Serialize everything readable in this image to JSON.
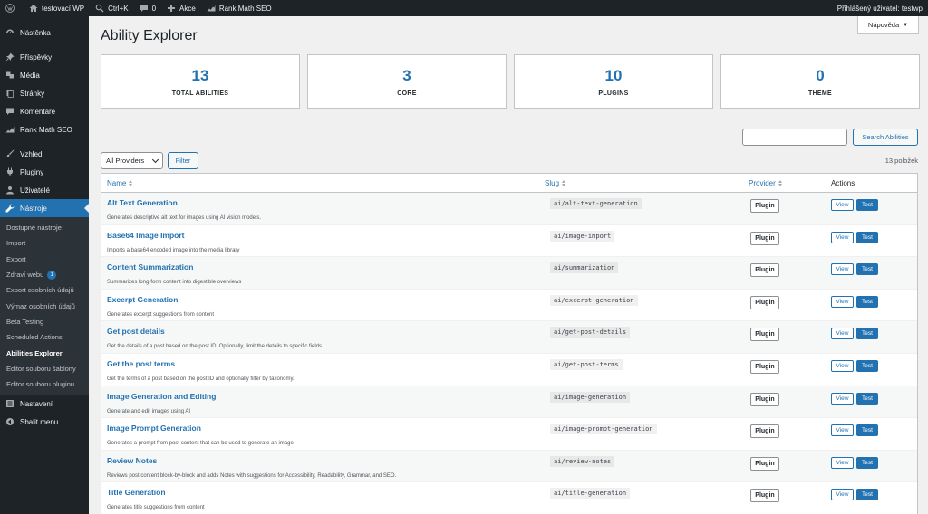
{
  "adminbar": {
    "site_name": "testovací WP",
    "shortcut": "Ctrl+K",
    "comments_count": "0",
    "new_label": "Akce",
    "rankmath_label": "Rank Math SEO",
    "user_greeting": "Přihlášený uživatel: testwp"
  },
  "sidebar": {
    "items": [
      {
        "label": "Nástěnka",
        "icon": "dashboard-icon"
      },
      {
        "label": "Příspěvky",
        "icon": "pin-icon"
      },
      {
        "label": "Média",
        "icon": "media-icon"
      },
      {
        "label": "Stránky",
        "icon": "pages-icon"
      },
      {
        "label": "Komentáře",
        "icon": "comment-icon"
      },
      {
        "label": "Rank Math SEO",
        "icon": "rankmath-icon"
      },
      {
        "label": "Vzhled",
        "icon": "brush-icon"
      },
      {
        "label": "Pluginy",
        "icon": "plugin-icon"
      },
      {
        "label": "Uživatelé",
        "icon": "users-icon"
      },
      {
        "label": "Nástroje",
        "icon": "wrench-icon"
      },
      {
        "label": "Nastavení",
        "icon": "settings-icon"
      },
      {
        "label": "Sbalit menu",
        "icon": "collapse-icon"
      }
    ],
    "submenu": [
      "Dostupné nástroje",
      "Import",
      "Export",
      "Zdraví webu",
      "Export osobních údajů",
      "Výmaz osobních údajů",
      "Beta Testing",
      "Scheduled Actions",
      "Abilities Explorer",
      "Editor souboru šablony",
      "Editor souboru pluginu"
    ],
    "health_badge": "1"
  },
  "main": {
    "help_label": "Nápověda",
    "title": "Ability Explorer",
    "stats": [
      {
        "value": "13",
        "label": "TOTAL ABILITIES"
      },
      {
        "value": "3",
        "label": "CORE"
      },
      {
        "value": "10",
        "label": "PLUGINS"
      },
      {
        "value": "0",
        "label": "THEME"
      }
    ],
    "search": {
      "value": "",
      "button_label": "Search Abilities"
    },
    "filter": {
      "selected": "All Providers",
      "button_label": "Filter"
    },
    "item_count": "13 položek",
    "table": {
      "headers": {
        "name": "Name",
        "slug": "Slug",
        "provider": "Provider",
        "actions": "Actions"
      },
      "view_label": "View",
      "test_label": "Test",
      "rows": [
        {
          "name": "Alt Text Generation",
          "desc": "Generates descriptive alt text for images using AI vision models.",
          "slug": "ai/alt-text-generation",
          "provider": "Plugin"
        },
        {
          "name": "Base64 Image Import",
          "desc": "Imports a base64 encoded image into the media library",
          "slug": "ai/image-import",
          "provider": "Plugin"
        },
        {
          "name": "Content Summarization",
          "desc": "Summarizes long-form content into digestible overviews",
          "slug": "ai/summarization",
          "provider": "Plugin"
        },
        {
          "name": "Excerpt Generation",
          "desc": "Generates excerpt suggestions from content",
          "slug": "ai/excerpt-generation",
          "provider": "Plugin"
        },
        {
          "name": "Get post details",
          "desc": "Get the details of a post based on the post ID. Optionally, limit the details to specific fields.",
          "slug": "ai/get-post-details",
          "provider": "Plugin"
        },
        {
          "name": "Get the post terms",
          "desc": "Get the terms of a post based on the post ID and optionally filter by taxonomy.",
          "slug": "ai/get-post-terms",
          "provider": "Plugin"
        },
        {
          "name": "Image Generation and Editing",
          "desc": "Generate and edit images using AI",
          "slug": "ai/image-generation",
          "provider": "Plugin"
        },
        {
          "name": "Image Prompt Generation",
          "desc": "Generates a prompt from post content that can be used to generate an image",
          "slug": "ai/image-prompt-generation",
          "provider": "Plugin"
        },
        {
          "name": "Review Notes",
          "desc": "Reviews post content block-by-block and adds Notes with suggestions for Accessibility, Readability, Grammar, and SEO.",
          "slug": "ai/review-notes",
          "provider": "Plugin"
        },
        {
          "name": "Title Generation",
          "desc": "Generates title suggestions from content",
          "slug": "ai/title-generation",
          "provider": "Plugin"
        }
      ]
    }
  }
}
